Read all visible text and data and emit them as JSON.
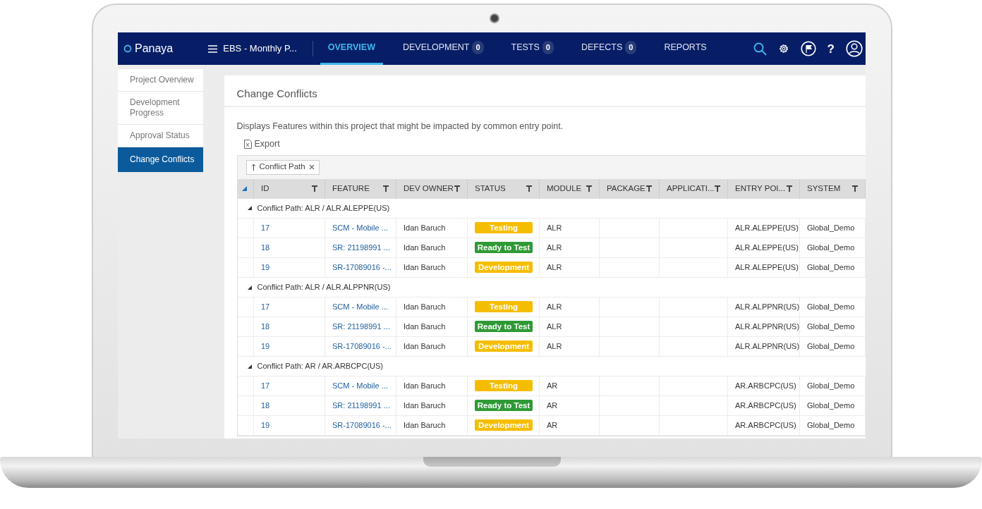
{
  "navbar": {
    "logo": "Panaya",
    "project": "EBS - Monthly P...",
    "tabs": [
      {
        "label": "OVERVIEW",
        "selected": true
      },
      {
        "label": "DEVELOPMENT",
        "count": "0",
        "selected": false
      },
      {
        "label": "TESTS",
        "count": "0",
        "selected": false
      },
      {
        "label": "DEFECTS",
        "count": "0",
        "selected": false
      },
      {
        "label": "REPORTS",
        "selected": false
      }
    ],
    "help": "?"
  },
  "sidebar": {
    "items": [
      {
        "label": "Project Overview",
        "selected": false
      },
      {
        "label": "Development Progress",
        "selected": false
      },
      {
        "label": "Approval Status",
        "selected": false
      },
      {
        "label": "Change Conflicts",
        "selected": true
      }
    ]
  },
  "panel": {
    "title": "Change Conflicts",
    "description": "Displays Features within this project that might be impacted by common entry point.",
    "export": "Export"
  },
  "grid": {
    "group_chip": "Conflict Path",
    "columns": [
      "ID",
      "FEATURE",
      "DEV OWNER",
      "STATUS",
      "MODULE",
      "PACKAGE",
      "APPLICATI...",
      "ENTRY POI...",
      "SYSTEM"
    ],
    "groups": [
      {
        "label": "Conflict Path: ALR / ALR.ALEPPE(US)",
        "expanded": true,
        "rows": [
          {
            "id": "17",
            "feature": "SCM - Mobile ...",
            "dev_owner": "Idan Baruch",
            "status": {
              "label": "Testing",
              "color": "#f5bd00"
            },
            "module": "ALR",
            "entry_point": "ALR.ALEPPE(US)",
            "system": "Global_Demo"
          },
          {
            "id": "18",
            "feature": "SR: 21198991 ...",
            "dev_owner": "Idan Baruch",
            "status": {
              "label": "Ready to Test",
              "color": "#2e9a35"
            },
            "module": "ALR",
            "entry_point": "ALR.ALEPPE(US)",
            "system": "Global_Demo"
          },
          {
            "id": "19",
            "feature": "SR-17089016 -...",
            "dev_owner": "Idan Baruch",
            "status": {
              "label": "Development",
              "color": "#f5bd00"
            },
            "module": "ALR",
            "entry_point": "ALR.ALEPPE(US)",
            "system": "Global_Demo"
          }
        ]
      },
      {
        "label": "Conflict Path: ALR / ALR.ALPPNR(US)",
        "expanded": true,
        "rows": [
          {
            "id": "17",
            "feature": "SCM - Mobile ...",
            "dev_owner": "Idan Baruch",
            "status": {
              "label": "Testing",
              "color": "#f5bd00"
            },
            "module": "ALR",
            "entry_point": "ALR.ALPPNR(US)",
            "system": "Global_Demo"
          },
          {
            "id": "18",
            "feature": "SR: 21198991 ...",
            "dev_owner": "Idan Baruch",
            "status": {
              "label": "Ready to Test",
              "color": "#2e9a35"
            },
            "module": "ALR",
            "entry_point": "ALR.ALPPNR(US)",
            "system": "Global_Demo"
          },
          {
            "id": "19",
            "feature": "SR-17089016 -...",
            "dev_owner": "Idan Baruch",
            "status": {
              "label": "Development",
              "color": "#f5bd00"
            },
            "module": "ALR",
            "entry_point": "ALR.ALPPNR(US)",
            "system": "Global_Demo"
          }
        ]
      },
      {
        "label": "Conflict Path: AR / AR.ARBCPC(US)",
        "expanded": true,
        "rows": [
          {
            "id": "17",
            "feature": "SCM - Mobile ...",
            "dev_owner": "Idan Baruch",
            "status": {
              "label": "Testing",
              "color": "#f5bd00"
            },
            "module": "AR",
            "entry_point": "AR.ARBCPC(US)",
            "system": "Global_Demo"
          },
          {
            "id": "18",
            "feature": "SR: 21198991 ...",
            "dev_owner": "Idan Baruch",
            "status": {
              "label": "Ready to Test",
              "color": "#2e9a35"
            },
            "module": "AR",
            "entry_point": "AR.ARBCPC(US)",
            "system": "Global_Demo"
          },
          {
            "id": "19",
            "feature": "SR-17089016 -...",
            "dev_owner": "Idan Baruch",
            "status": {
              "label": "Development",
              "color": "#f5bd00"
            },
            "module": "AR",
            "entry_point": "AR.ARBCPC(US)",
            "system": "Global_Demo"
          }
        ]
      }
    ]
  }
}
